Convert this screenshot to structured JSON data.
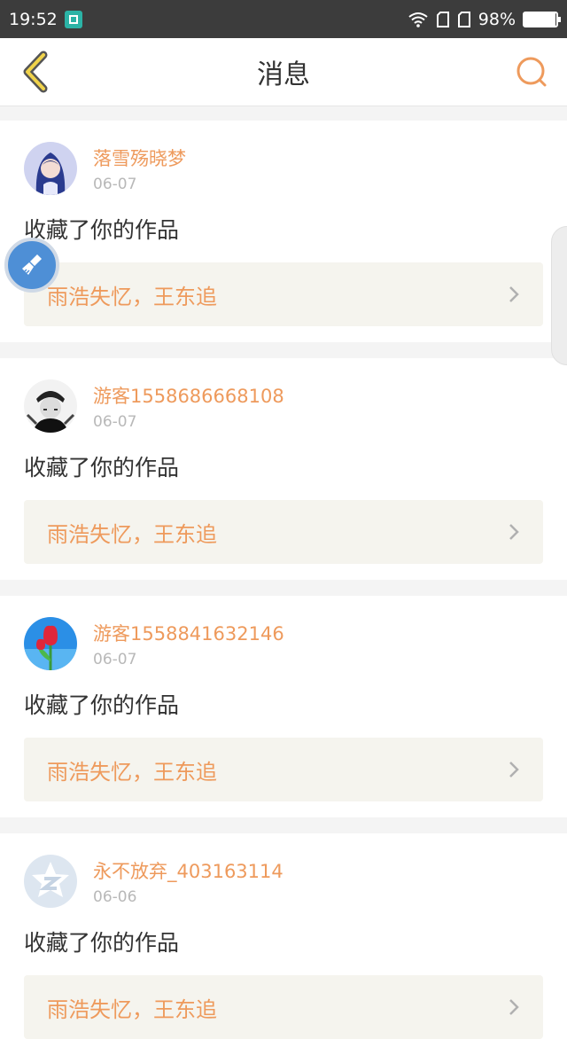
{
  "statusbar": {
    "time": "19:52",
    "battery_text": "98%",
    "battery_level": 0.98
  },
  "header": {
    "title": "消息",
    "accent_color": "#ee9a5c"
  },
  "messages": [
    {
      "username": "落雪殇晓梦",
      "date": "06-07",
      "action": "收藏了你的作品",
      "work_title": "雨浩失忆，王东追",
      "avatar": "anime"
    },
    {
      "username": "游客1558686668108",
      "date": "06-07",
      "action": "收藏了你的作品",
      "work_title": "雨浩失忆，王东追",
      "avatar": "grayscale-photo"
    },
    {
      "username": "游客1558841632146",
      "date": "06-07",
      "action": "收藏了你的作品",
      "work_title": "雨浩失忆，王东追",
      "avatar": "tulip"
    },
    {
      "username": "永不放弃_403163114",
      "date": "06-06",
      "action": "收藏了你的作品",
      "work_title": "雨浩失忆，王东追",
      "avatar": "qzone-default"
    }
  ],
  "icons": {
    "back": "chevron-left-icon",
    "search": "search-icon",
    "floating": "broom-icon",
    "item_arrow": "chevron-right-icon"
  }
}
